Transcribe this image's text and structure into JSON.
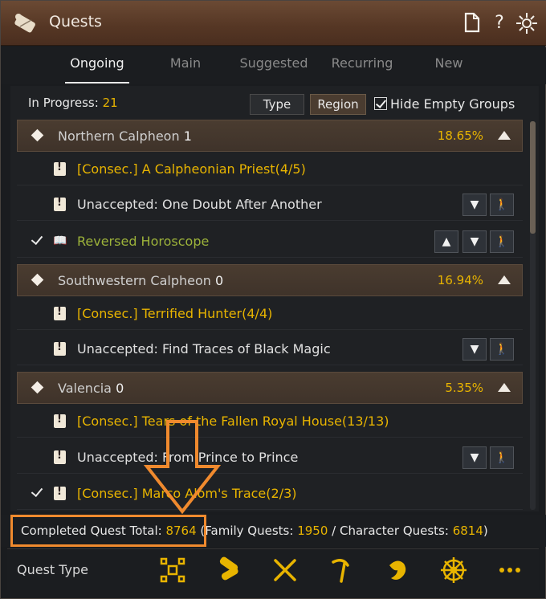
{
  "window": {
    "title": "Quests"
  },
  "tabs": [
    {
      "label": "Ongoing",
      "active": true
    },
    {
      "label": "Main",
      "active": false
    },
    {
      "label": "Suggested",
      "active": false
    },
    {
      "label": "Recurring",
      "active": false
    },
    {
      "label": "New",
      "active": false
    }
  ],
  "filters": {
    "in_progress_label": "In Progress:",
    "in_progress_count": "21",
    "type_label": "Type",
    "region_label": "Region",
    "hide_empty_label": "Hide Empty Groups",
    "hide_empty_checked": true
  },
  "groups": [
    {
      "name": "Northern Calpheon",
      "count": "1",
      "percent": "18.65%",
      "quests": [
        {
          "title": "[Consec.] A Calpheonian Priest(4/5)",
          "style": "consec",
          "tracked": false,
          "actions": []
        },
        {
          "title": "Unaccepted: One Doubt After Another",
          "style": "unacc",
          "tracked": false,
          "actions": [
            "down",
            "navigate"
          ]
        },
        {
          "title": "Reversed Horoscope",
          "style": "green",
          "tracked": true,
          "actions": [
            "up",
            "down",
            "navigate"
          ]
        }
      ]
    },
    {
      "name": "Southwestern Calpheon",
      "count": "0",
      "percent": "16.94%",
      "quests": [
        {
          "title": "[Consec.] Terrified Hunter(4/4)",
          "style": "consec",
          "tracked": false,
          "actions": []
        },
        {
          "title": "Unaccepted: Find Traces of Black Magic",
          "style": "unacc",
          "tracked": false,
          "actions": [
            "down",
            "navigate"
          ]
        }
      ]
    },
    {
      "name": "Valencia",
      "count": "0",
      "percent": "5.35%",
      "quests": [
        {
          "title": "[Consec.] Tears of the Fallen Royal House(13/13)",
          "style": "consec",
          "tracked": false,
          "actions": []
        },
        {
          "title": "Unaccepted: From Prince to Prince",
          "style": "unacc",
          "tracked": false,
          "actions": [
            "down",
            "navigate"
          ]
        },
        {
          "title": "[Consec.] Marco Alom's Trace(2/3)",
          "style": "consec",
          "tracked": true,
          "actions": []
        }
      ]
    }
  ],
  "completed": {
    "label": "Completed Quest Total:",
    "total": "8764",
    "family_label": "(Family Quests:",
    "family": "1950",
    "char_label": "/ Character Quests:",
    "char": "6814",
    "close": ")"
  },
  "quest_type": {
    "label": "Quest Type",
    "icons": [
      "select-all-icon",
      "scroll-icon",
      "crossed-swords-icon",
      "pickaxe-icon",
      "fish-icon",
      "ship-wheel-icon",
      "more-icon"
    ]
  },
  "colors": {
    "accent_gold": "#e8b400",
    "highlight_orange": "#f08a2e"
  }
}
